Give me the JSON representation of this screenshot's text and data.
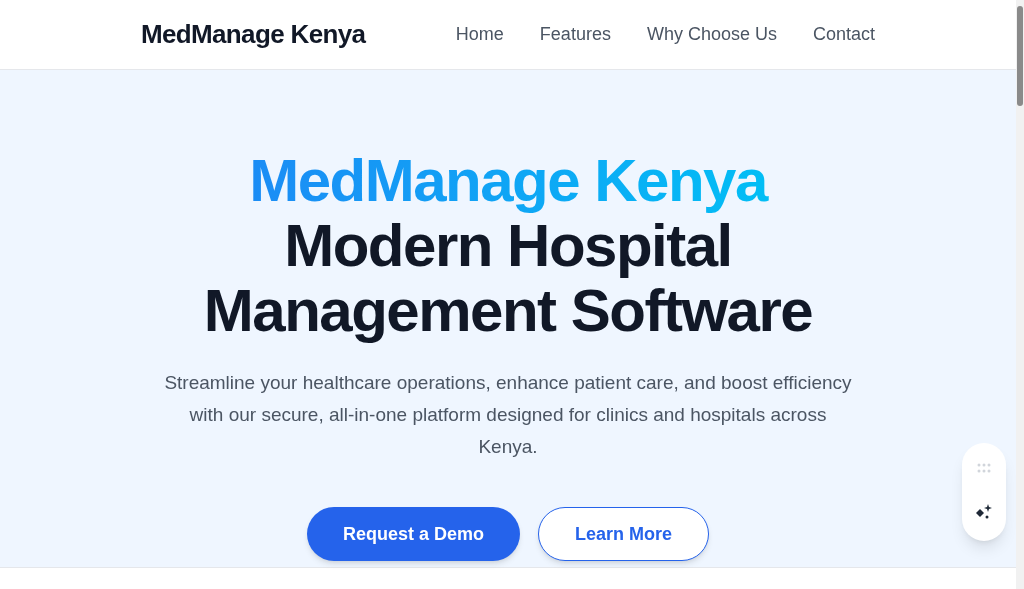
{
  "header": {
    "brand": "MedManage Kenya",
    "nav": [
      "Home",
      "Features",
      "Why Choose Us",
      "Contact"
    ]
  },
  "hero": {
    "title_highlight": "MedManage Kenya",
    "title_lines": [
      "Modern Hospital",
      "Management Software"
    ],
    "subtitle": "Streamline your healthcare operations, enhance patient care, and boost efficiency with our secure, all-in-one platform designed for clinics and hospitals across Kenya.",
    "buttons": [
      {
        "label": "Request a Demo",
        "kind": "primary"
      },
      {
        "label": "Learn More",
        "kind": "outline"
      }
    ]
  }
}
